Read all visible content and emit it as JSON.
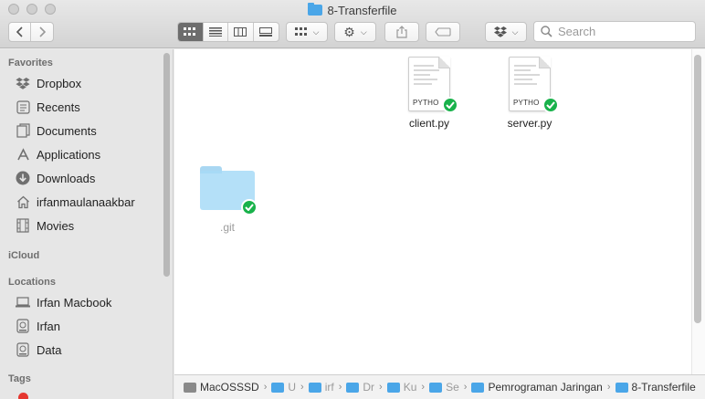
{
  "window": {
    "title": "8-Transferfile"
  },
  "toolbar": {
    "back_icon": "chevron-left-icon",
    "forward_icon": "chevron-right-icon",
    "view_modes": [
      "icon-view",
      "list-view",
      "column-view",
      "gallery-view"
    ],
    "active_view": "icon-view",
    "search_placeholder": "Search"
  },
  "sidebar": {
    "favorites_label": "Favorites",
    "favorites": [
      {
        "label": "Dropbox",
        "icon": "dropbox-icon"
      },
      {
        "label": "Recents",
        "icon": "recents-icon"
      },
      {
        "label": "Documents",
        "icon": "documents-icon"
      },
      {
        "label": "Applications",
        "icon": "applications-icon"
      },
      {
        "label": "Downloads",
        "icon": "downloads-icon"
      },
      {
        "label": "irfanmaulanaakbar",
        "icon": "home-icon"
      },
      {
        "label": "Movies",
        "icon": "movies-icon"
      }
    ],
    "icloud_label": "iCloud",
    "locations_label": "Locations",
    "locations": [
      {
        "label": "Irfan Macbook",
        "icon": "laptop-icon"
      },
      {
        "label": "Irfan",
        "icon": "disk-icon"
      },
      {
        "label": "Data",
        "icon": "disk-icon"
      }
    ],
    "tags_label": "Tags"
  },
  "files": [
    {
      "name": "client.py",
      "kind": "PYTHO",
      "synced": true
    },
    {
      "name": "server.py",
      "kind": "PYTHO",
      "synced": true
    },
    {
      "name": ".git",
      "kind": "folder",
      "synced": true,
      "hidden": true
    }
  ],
  "pathbar": {
    "crumbs": [
      "MacOSSSD",
      "U",
      "irf",
      "Dr",
      "Ku",
      "Se",
      "Pemrograman Jaringan",
      "8-Transferfile"
    ]
  },
  "colors": {
    "sync_badge": "#19b24b",
    "folder": "#4aa6e8"
  }
}
